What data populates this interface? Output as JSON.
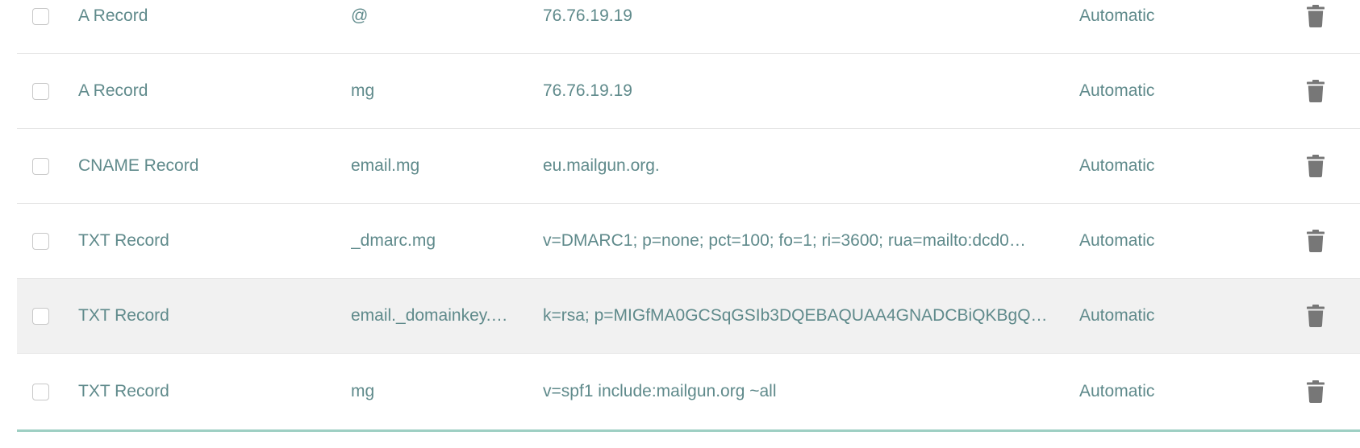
{
  "records": [
    {
      "type": "A Record",
      "host": "@",
      "value": "76.76.19.19",
      "ttl": "Automatic",
      "highlighted": false
    },
    {
      "type": "A Record",
      "host": "mg",
      "value": "76.76.19.19",
      "ttl": "Automatic",
      "highlighted": false
    },
    {
      "type": "CNAME Record",
      "host": "email.mg",
      "value": "eu.mailgun.org.",
      "ttl": "Automatic",
      "highlighted": false
    },
    {
      "type": "TXT Record",
      "host": "_dmarc.mg",
      "value": "v=DMARC1; p=none; pct=100; fo=1; ri=3600; rua=mailto:dcd0…",
      "ttl": "Automatic",
      "highlighted": false
    },
    {
      "type": "TXT Record",
      "host": "email._domainkey.…",
      "value": "k=rsa; p=MIGfMA0GCSqGSIb3DQEBAQUAA4GNADCBiQKBgQ…",
      "ttl": "Automatic",
      "highlighted": true
    },
    {
      "type": "TXT Record",
      "host": "mg",
      "value": "v=spf1 include:mailgun.org ~all",
      "ttl": "Automatic",
      "highlighted": false
    }
  ],
  "icons": {
    "delete": "trash-icon",
    "select": "checkbox"
  },
  "colors": {
    "text": "#5f8a8b",
    "row_highlight": "#f1f1f1",
    "divider": "#e5e5e5",
    "table_bottom_border": "#9ecfc3",
    "trash_icon": "#777777"
  }
}
